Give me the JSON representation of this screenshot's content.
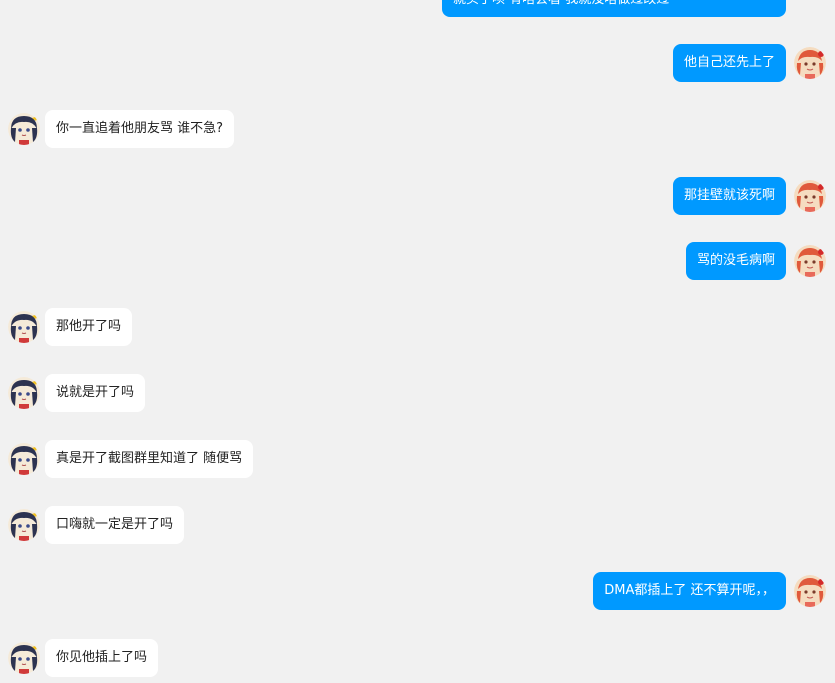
{
  "conversation": {
    "messages": [
      {
        "side": "right",
        "text": "就买了呗 有啥会看 我就没啥做过改过",
        "partial": true
      },
      {
        "side": "right",
        "text": "他自己还先上了"
      },
      {
        "side": "left",
        "text": "你一直追着他朋友骂 谁不急?"
      },
      {
        "side": "right",
        "text": "那挂壁就该死啊"
      },
      {
        "side": "right",
        "text": "骂的没毛病啊"
      },
      {
        "side": "left",
        "text": "那他开了吗"
      },
      {
        "side": "left",
        "text": "说就是开了吗"
      },
      {
        "side": "left",
        "text": "真是开了截图群里知道了 随便骂"
      },
      {
        "side": "left",
        "text": "口嗨就一定是开了吗"
      },
      {
        "side": "right",
        "text": "DMA都插上了 还不算开呢，，"
      },
      {
        "side": "left",
        "text": "你见他插上了吗"
      }
    ]
  },
  "theme": {
    "background": "#f1f1f1",
    "outgoing_bubble": "#0099ff",
    "incoming_bubble": "#ffffff"
  },
  "avatars": {
    "self_icon": "red-hair-girl-avatar",
    "other_icon": "dark-hair-girl-avatar"
  }
}
